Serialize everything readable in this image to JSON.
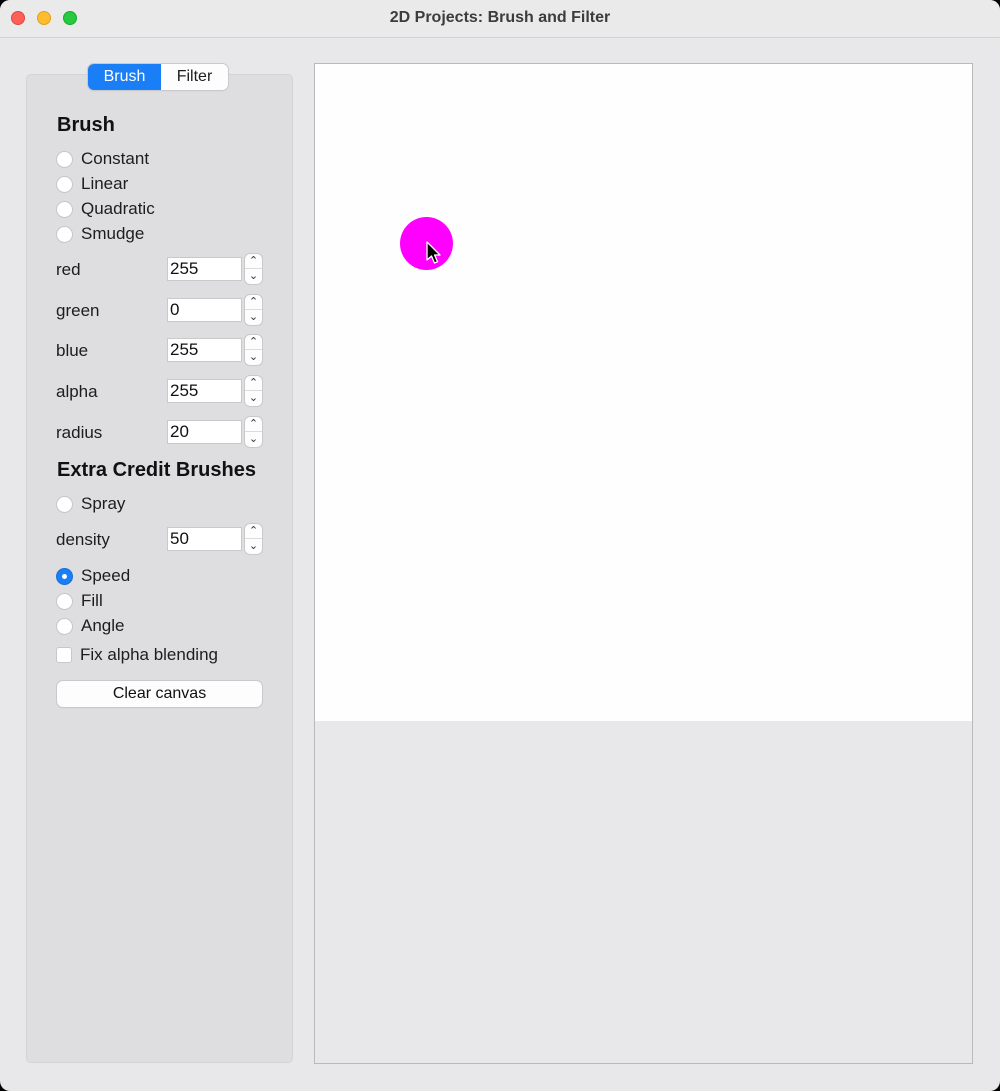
{
  "window": {
    "title": "2D Projects: Brush and Filter"
  },
  "tabs": [
    {
      "label": "Brush",
      "active": true
    },
    {
      "label": "Filter",
      "active": false
    }
  ],
  "brush": {
    "heading": "Brush",
    "types": [
      {
        "label": "Constant",
        "checked": false
      },
      {
        "label": "Linear",
        "checked": false
      },
      {
        "label": "Quadratic",
        "checked": false
      },
      {
        "label": "Smudge",
        "checked": false
      }
    ],
    "fields": {
      "red": {
        "label": "red",
        "value": "255"
      },
      "green": {
        "label": "green",
        "value": "0"
      },
      "blue": {
        "label": "blue",
        "value": "255"
      },
      "alpha": {
        "label": "alpha",
        "value": "255"
      },
      "radius": {
        "label": "radius",
        "value": "20"
      }
    }
  },
  "extra": {
    "heading": "Extra Credit Brushes",
    "spray": {
      "label": "Spray",
      "checked": false
    },
    "density": {
      "label": "density",
      "value": "50"
    },
    "options": [
      {
        "label": "Speed",
        "checked": true
      },
      {
        "label": "Fill",
        "checked": false
      },
      {
        "label": "Angle",
        "checked": false
      }
    ],
    "fix_alpha": {
      "label": "Fix alpha blending",
      "checked": false
    }
  },
  "clear_button": "Clear canvas",
  "icons": {
    "stepper_up": "chevron-up-icon",
    "stepper_down": "chevron-down-icon",
    "cursor": "arrow-cursor-icon"
  },
  "colors": {
    "accent": "#1a7ef6",
    "brush_stroke": "#ff00ff"
  }
}
